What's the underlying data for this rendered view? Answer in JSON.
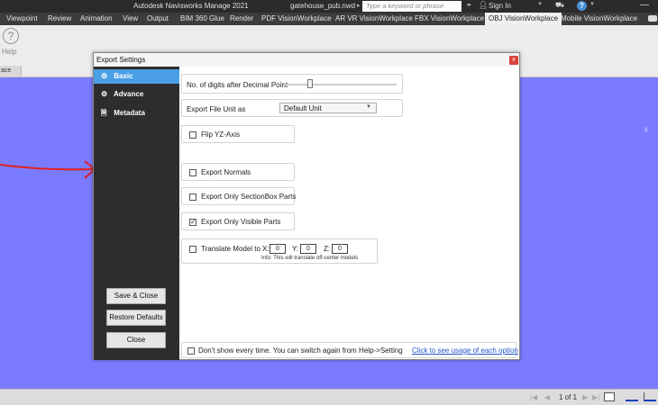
{
  "titlebar": {
    "app_title": "Autodesk Navisworks Manage 2021",
    "file_title": "gatehouse_pub.nwd",
    "search_placeholder": "Type a keyword or phrase",
    "sign_in": "Sign In"
  },
  "ribbon_tabs": [
    "Viewpoint",
    "Review",
    "Animation",
    "View",
    "Output",
    "BIM 360 Glue",
    "Render",
    "PDF VisionWorkplace",
    "AR VR VisionWorkplace",
    "FBX VisionWorkplace",
    "OBJ VisionWorkplace",
    "Mobile VisionWorkplace"
  ],
  "active_tab": "OBJ VisionWorkplace",
  "ribbon": {
    "help_label": "Help",
    "panel_label": "ace"
  },
  "dialog": {
    "title": "Export Settings",
    "close_label": "x",
    "sidebar": {
      "items": [
        {
          "label": "Basic",
          "icon": "gear-icon",
          "active": true
        },
        {
          "label": "Advance",
          "icon": "gears-icon",
          "active": false
        },
        {
          "label": "Metadata",
          "icon": "document-gear-icon",
          "active": false
        }
      ],
      "buttons": {
        "save_close": "Save & Close",
        "restore_defaults": "Restore Defaults",
        "close": "Close"
      }
    },
    "decimal_point": {
      "label": "No. of digits after Decimal Point"
    },
    "unit": {
      "label": "Export File Unit as",
      "value": "Default Unit"
    },
    "options": [
      {
        "label": "Flip YZ-Axis",
        "checked": false
      },
      {
        "label": "Export Normals",
        "checked": false
      },
      {
        "label": "Export Only SectionBox Parts",
        "checked": false
      },
      {
        "label": "Export Only Visible Parts",
        "checked": true
      }
    ],
    "translate": {
      "label": "Translate Model to",
      "checked": false,
      "x_label": "X:",
      "x_value": "0",
      "y_label": "Y:",
      "y_value": "0",
      "z_label": "Z:",
      "z_value": "0",
      "info": "Info: This will translate off-center models"
    },
    "footer": {
      "dont_show": "Don't show every time. You can switch again from Help->Setting",
      "link": "Click to see usage of each option"
    }
  },
  "statusbar": {
    "pages": "1 of 1"
  },
  "colors": {
    "viewport_bg": "#7b7bff",
    "sidebar_bg": "#2d2d2d",
    "sidebar_active": "#4a9fe5",
    "arrow": "#e02020",
    "link": "#2255cc"
  }
}
